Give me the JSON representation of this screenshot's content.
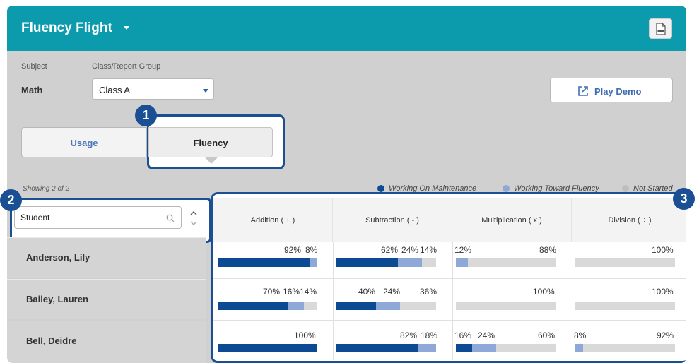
{
  "app": {
    "title": "Fluency Flight",
    "pdf_icon": "pdf-file-icon"
  },
  "filters": {
    "subject_label": "Subject",
    "subject_value": "Math",
    "group_label": "Class/Report Group",
    "group_value": "Class A"
  },
  "play_demo": {
    "label": "Play Demo",
    "icon": "external-link-icon"
  },
  "tabs": [
    {
      "label": "Usage"
    },
    {
      "label": "Fluency",
      "selected": true
    }
  ],
  "callouts": [
    "1",
    "2",
    "3"
  ],
  "showing": "Showing 2 of 2",
  "legend": [
    {
      "label": "Working On Maintenance",
      "color": "#0d4a94"
    },
    {
      "label": "Working Toward Fluency",
      "color": "#8ea9d8"
    },
    {
      "label": "Not Started",
      "color": "#c9c9c9"
    }
  ],
  "search": {
    "value": "Student",
    "icon": "search-icon"
  },
  "columns": [
    "Addition ( + )",
    "Subtraction ( - )",
    "Multiplication ( x )",
    "Division ( ÷ )"
  ],
  "students": [
    {
      "name": "Anderson, Lily",
      "cells": [
        {
          "labels": [
            "92%",
            "8%",
            ""
          ],
          "values": [
            92,
            8,
            0
          ]
        },
        {
          "labels": [
            "62%",
            "24%",
            "14%"
          ],
          "values": [
            62,
            24,
            14
          ]
        },
        {
          "labels": [
            "",
            "12%",
            "88%"
          ],
          "values": [
            0,
            12,
            88
          ]
        },
        {
          "labels": [
            "",
            "",
            "100%"
          ],
          "values": [
            0,
            0,
            100
          ]
        }
      ]
    },
    {
      "name": "Bailey, Lauren",
      "cells": [
        {
          "labels": [
            "70%",
            "16%",
            "14%"
          ],
          "values": [
            70,
            16,
            14
          ]
        },
        {
          "labels": [
            "40%",
            "24%",
            "36%"
          ],
          "values": [
            40,
            24,
            36
          ]
        },
        {
          "labels": [
            "",
            "",
            "100%"
          ],
          "values": [
            0,
            0,
            100
          ]
        },
        {
          "labels": [
            "",
            "",
            "100%"
          ],
          "values": [
            0,
            0,
            100
          ]
        }
      ]
    },
    {
      "name": "Bell, Deidre",
      "cells": [
        {
          "labels": [
            "100%",
            "",
            ""
          ],
          "values": [
            100,
            0,
            0
          ]
        },
        {
          "labels": [
            "82%",
            "18%",
            ""
          ],
          "values": [
            82,
            18,
            0
          ]
        },
        {
          "labels": [
            "16%",
            "24%",
            "60%"
          ],
          "values": [
            16,
            24,
            60
          ]
        },
        {
          "labels": [
            "",
            "8%",
            "92%"
          ],
          "values": [
            0,
            8,
            92
          ]
        }
      ]
    }
  ],
  "colors": {
    "header": "#0b9bad",
    "maintenance": "#0d4a94",
    "toward": "#8ea9d8",
    "not_started": "#d9d9d9",
    "callout": "#1a4f93"
  }
}
